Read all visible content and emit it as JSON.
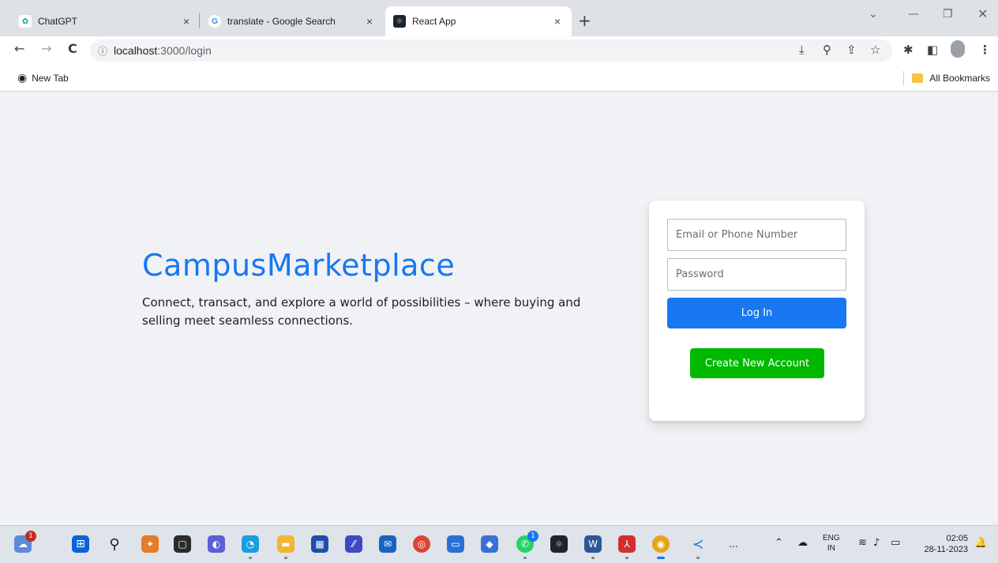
{
  "browser": {
    "tabs": [
      {
        "title": "ChatGPT",
        "close": "×"
      },
      {
        "title": "translate - Google Search",
        "close": "×"
      },
      {
        "title": "React App",
        "close": "×"
      }
    ],
    "new_tab_symbol": "+",
    "address": {
      "host": "localhost",
      "path": ":3000/login"
    },
    "bookmarks": {
      "left_item": "New Tab",
      "right_item": "All Bookmarks"
    }
  },
  "page": {
    "brand": "CampusMarketplace",
    "tagline": "Connect, transact, and explore a world of possibilities – where buying and selling meet seamless connections.",
    "login_form": {
      "email_placeholder": "Email or Phone Number",
      "password_placeholder": "Password",
      "login_label": "Log In",
      "create_label": "Create New Account"
    }
  },
  "taskbar": {
    "notification_count": "1",
    "whatsapp_count": "1",
    "language_top": "ENG",
    "language_bottom": "IN",
    "time": "02:05",
    "date": "28-11-2023",
    "overflow": "..."
  },
  "colors": {
    "brand": "#1877f2",
    "login_button": "#1877f2",
    "create_button": "#00b800",
    "page_background": "#f0f2f5"
  }
}
